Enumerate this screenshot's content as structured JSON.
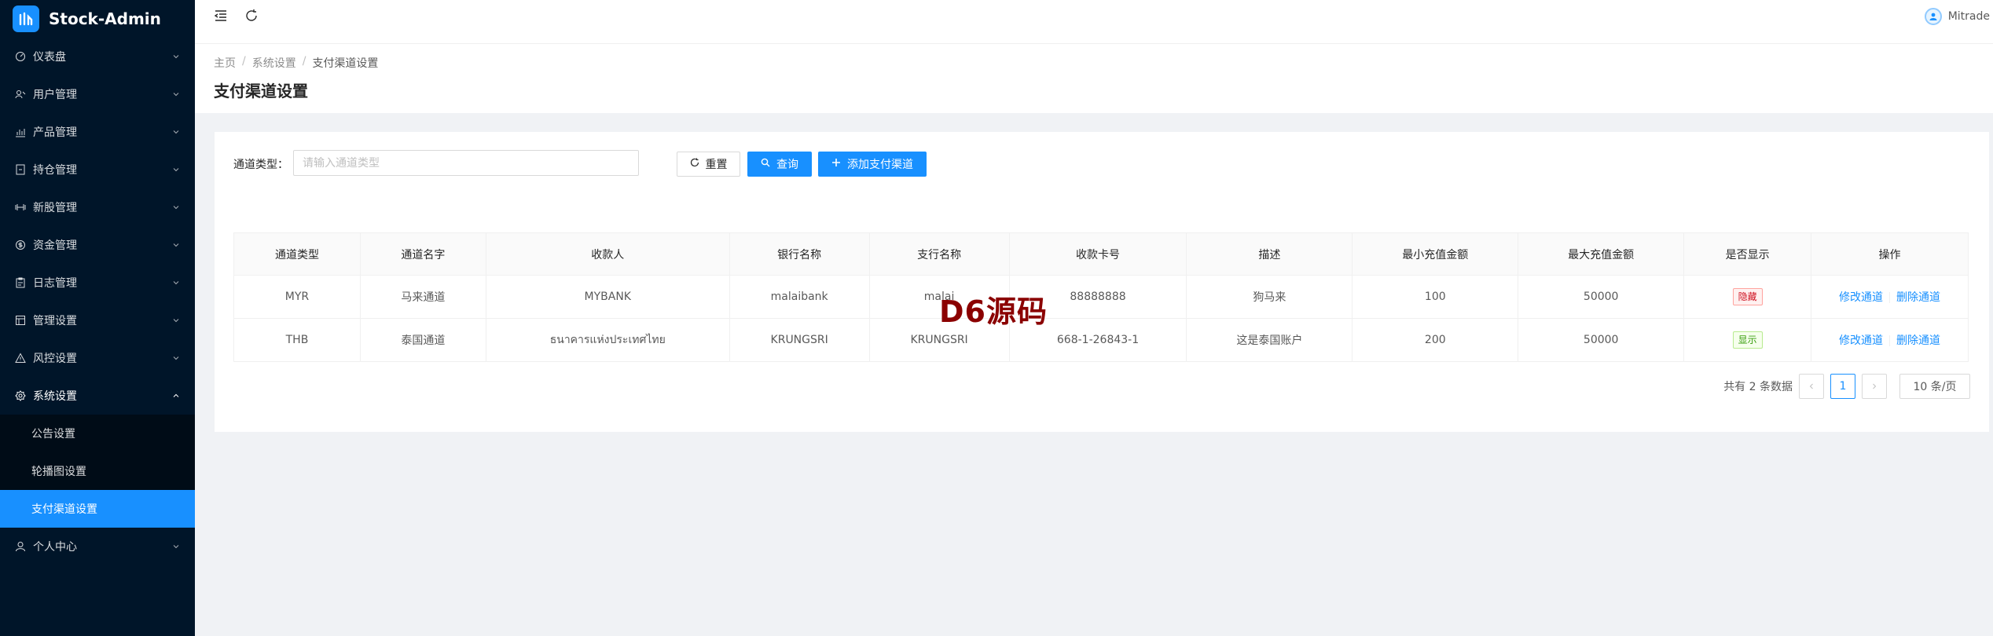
{
  "app": {
    "title": "Stock-Admin"
  },
  "sidebar": {
    "items": [
      {
        "label": "仪表盘",
        "icon": "dashboard-icon"
      },
      {
        "label": "用户管理",
        "icon": "user-group-icon"
      },
      {
        "label": "产品管理",
        "icon": "bar-chart-icon"
      },
      {
        "label": "持仓管理",
        "icon": "file-icon"
      },
      {
        "label": "新股管理",
        "icon": "dumbbell-icon"
      },
      {
        "label": "资金管理",
        "icon": "dollar-circle-icon"
      },
      {
        "label": "日志管理",
        "icon": "clipboard-icon"
      },
      {
        "label": "管理设置",
        "icon": "table-icon"
      },
      {
        "label": "风控设置",
        "icon": "warning-icon"
      },
      {
        "label": "系统设置",
        "icon": "settings-icon"
      },
      {
        "label": "个人中心",
        "icon": "person-icon"
      }
    ],
    "sub_items": [
      {
        "label": "公告设置"
      },
      {
        "label": "轮播图设置"
      },
      {
        "label": "支付渠道设置"
      }
    ]
  },
  "header": {
    "user_name": "Mitrade"
  },
  "breadcrumb": [
    "主页",
    "系统设置",
    "支付渠道设置"
  ],
  "page": {
    "title": "支付渠道设置"
  },
  "search": {
    "label": "通道类型：",
    "placeholder": "请输入通道类型",
    "reset_label": "重置",
    "query_label": "查询",
    "add_label": "添加支付渠道"
  },
  "table": {
    "columns": [
      "通道类型",
      "通道名字",
      "收款人",
      "银行名称",
      "支行名称",
      "收款卡号",
      "描述",
      "最小充值金额",
      "最大充值金额",
      "是否显示",
      "操作"
    ],
    "rows": [
      {
        "type": "MYR",
        "name": "马来通道",
        "payee": "MYBANK",
        "bank": "malaibank",
        "branch": "malai",
        "card": "88888888",
        "desc": "狗马来",
        "min": "100",
        "max": "50000",
        "visible": "隐藏",
        "visible_color": "#cf1322"
      },
      {
        "type": "THB",
        "name": "泰国通道",
        "payee": "ธนาคารแห่งประเทศไทย",
        "bank": "KRUNGSRI",
        "branch": "KRUNGSRI",
        "card": "668-1-26843-1",
        "desc": "这是泰国账户",
        "min": "200",
        "max": "50000",
        "visible": "显示",
        "visible_color": "#389e0d"
      }
    ],
    "edit_label": "修改通道",
    "delete_label": "删除通道"
  },
  "pagination": {
    "total_text": "共有 2 条数据",
    "current_page": "1",
    "page_size": "10 条/页"
  },
  "watermark": "D6源码"
}
